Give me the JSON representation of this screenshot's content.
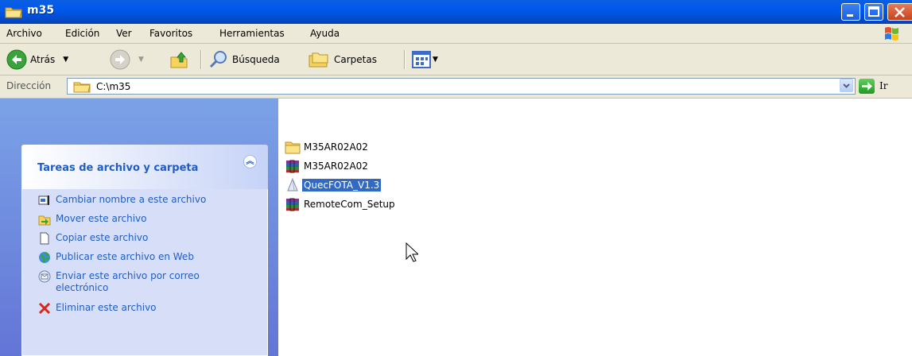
{
  "window": {
    "title": "m35"
  },
  "menu": {
    "items": [
      "Archivo",
      "Edición",
      "Ver",
      "Favoritos",
      "Herramientas",
      "Ayuda"
    ]
  },
  "toolbar": {
    "back_label": "Atrás",
    "search_label": "Búsqueda",
    "folders_label": "Carpetas"
  },
  "address": {
    "label": "Dirección",
    "value": "C:\\m35",
    "go_label": "Ir"
  },
  "tasks": {
    "title": "Tareas de archivo y carpeta",
    "items": [
      "Cambiar nombre a este archivo",
      "Mover este archivo",
      "Copiar este archivo",
      "Publicar este archivo en Web",
      "Enviar este archivo por correo electrónico",
      "Eliminar este archivo"
    ]
  },
  "files": [
    {
      "name": "M35AR02A02",
      "icon": "folder-icon",
      "selected": false
    },
    {
      "name": "M35AR02A02",
      "icon": "archive-icon",
      "selected": false
    },
    {
      "name": "QuecFOTA_V1.3",
      "icon": "app-icon",
      "selected": true
    },
    {
      "name": "RemoteCom_Setup",
      "icon": "archive-icon",
      "selected": false
    }
  ],
  "colors": {
    "title_blue": "#0058ee",
    "task_link": "#215dc6",
    "selection": "#316ac5"
  }
}
